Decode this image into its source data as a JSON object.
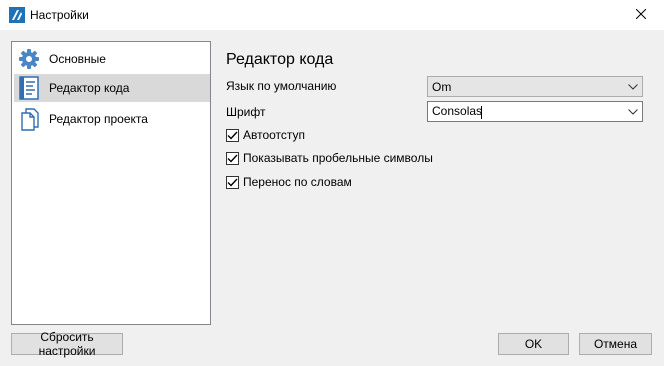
{
  "window": {
    "title": "Настройки",
    "app_icon": "app-logo-icon",
    "close_icon": "close-icon"
  },
  "sidebar": {
    "items": [
      {
        "label": "Основные",
        "icon": "gear-icon",
        "selected": false
      },
      {
        "label": "Редактор кода",
        "icon": "code-document-icon",
        "selected": true
      },
      {
        "label": "Редактор проекта",
        "icon": "project-document-icon",
        "selected": false
      }
    ]
  },
  "main": {
    "title": "Редактор кода",
    "default_language": {
      "label": "Язык по умолчанию",
      "value": "Om"
    },
    "font": {
      "label": "Шрифт",
      "value": "Consolas"
    },
    "checkboxes": [
      {
        "label": "Автоотступ",
        "checked": true
      },
      {
        "label": "Показывать пробельные символы",
        "checked": true
      },
      {
        "label": "Перенос по словам",
        "checked": true
      }
    ]
  },
  "footer": {
    "reset_label": "Сбросить настройки",
    "ok_label": "OK",
    "cancel_label": "Отмена"
  },
  "colors": {
    "accent": "#1e73b8",
    "selection": "#d9d9d9",
    "background": "#f0f0f0"
  }
}
